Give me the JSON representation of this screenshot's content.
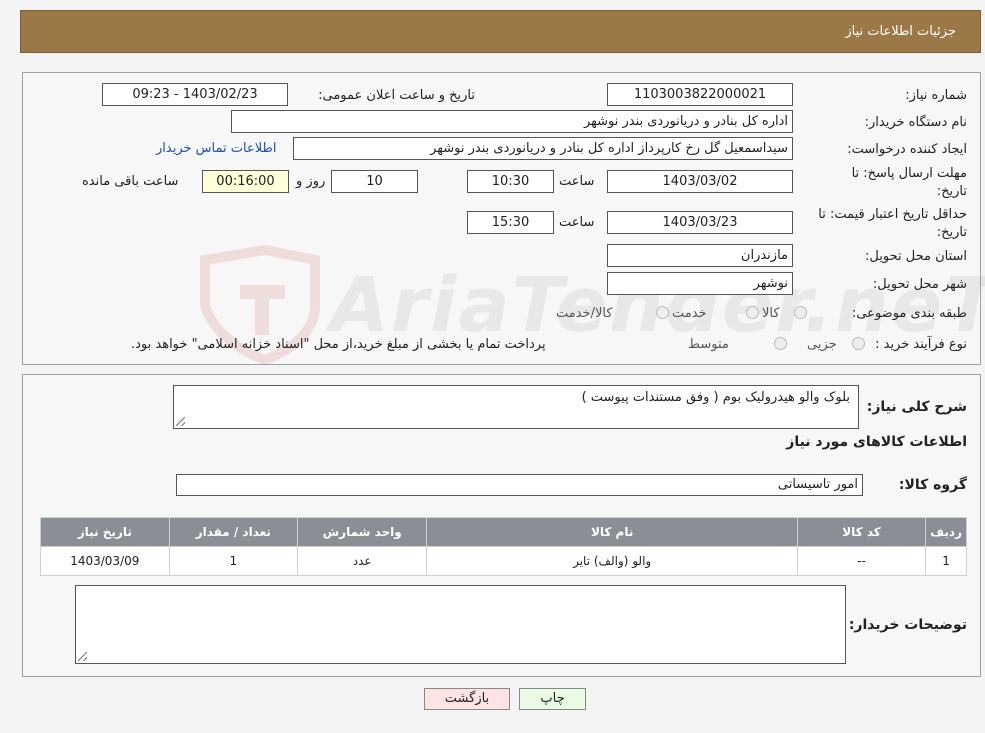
{
  "header": {
    "title": "جزئیات اطلاعات نیاز"
  },
  "watermark_text": "AriaTender.neT",
  "form": {
    "need_number_label": "شماره نیاز:",
    "need_number": "1103003822000021",
    "announce_label": "تاریخ و ساعت اعلان عمومی:",
    "announce_value": "1403/02/23 - 09:23",
    "buyer_label": "نام دستگاه خریدار:",
    "buyer_value": "اداره کل بنادر و دریانوردی بندر نوشهر",
    "creator_label": "ایجاد کننده درخواست:",
    "creator_value": "سیداسمعیل گل رخ کارپرداز اداره کل بنادر و دریانوردی بندر نوشهر",
    "contact_link": "اطلاعات تماس خریدار",
    "deadline_label_1": "مهلت ارسال پاسخ: تا",
    "deadline_label_2": "تاریخ:",
    "deadline_date": "1403/03/02",
    "time_label": "ساعت",
    "deadline_time": "10:30",
    "days_value": "10",
    "days_label": "روز و",
    "remaining_time": "00:16:00",
    "remaining_label": "ساعت باقی مانده",
    "validity_label_1": "حداقل تاریخ اعتبار قیمت: تا",
    "validity_label_2": "تاریخ:",
    "validity_date": "1403/03/23",
    "validity_time": "15:30",
    "province_label": "استان محل تحویل:",
    "province_value": "مازندران",
    "city_label": "شهر محل تحویل:",
    "city_value": "نوشهر",
    "category_label": "طبقه بندی موضوعی:",
    "category_options": [
      "کالا",
      "خدمت",
      "کالا/خدمت"
    ],
    "process_label": "نوع فرآیند خرید :",
    "process_options": [
      "جزیی",
      "متوسط"
    ],
    "process_note": "پرداخت تمام یا بخشی از مبلغ خرید،از محل \"اسناد خزانه اسلامی\" خواهد بود."
  },
  "summary": {
    "label": "شرح کلی نیاز:",
    "value": "بلوک والو هیدرولیک بوم ( وفق مستندات پیوست )",
    "items_title": "اطلاعات کالاهای مورد نیاز",
    "group_label": "گروه کالا:",
    "group_value": "امور تاسیساتی"
  },
  "table": {
    "headers": [
      "ردیف",
      "کد کالا",
      "نام کالا",
      "واحد شمارش",
      "تعداد / مقدار",
      "تاریخ نیاز"
    ],
    "rows": [
      [
        "1",
        "--",
        "والو (والف) تایر",
        "عدد",
        "1",
        "1403/03/09"
      ]
    ]
  },
  "notes": {
    "label": "توضیحات خریدار:",
    "value": ""
  },
  "buttons": {
    "print": "چاپ",
    "back": "بازگشت"
  },
  "colors": {
    "header_bg": "#9b7845",
    "table_header_bg": "#898f95",
    "back_button_bg": "#fde3e3",
    "print_button_bg": "#e9fbe2"
  }
}
